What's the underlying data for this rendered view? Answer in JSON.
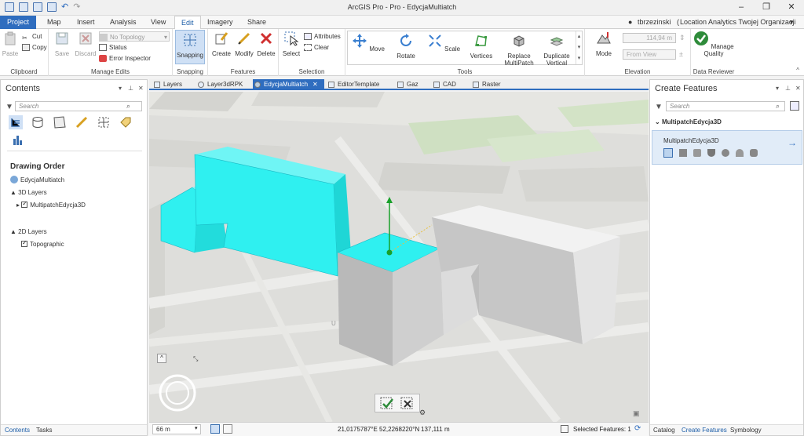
{
  "app_title": "ArcGIS Pro - Pro - EdycjaMultiatch",
  "window_controls": [
    "–",
    "❐",
    "✕"
  ],
  "tabs": [
    "Project",
    "Map",
    "Insert",
    "Analysis",
    "View",
    "Edit",
    "Imagery",
    "Share"
  ],
  "active_tab": "Edit",
  "user": "tbrzezinski",
  "organization": "Location Analytics Twojej Organizacji",
  "clipboard": {
    "paste": "Paste",
    "cut": "Cut",
    "copy": "Copy",
    "label": "Clipboard"
  },
  "manage_edits": {
    "save": "Save",
    "discard": "Discard",
    "topology": "No Topology",
    "status": "Status",
    "error_inspector": "Error Inspector",
    "label": "Manage Edits"
  },
  "snapping": {
    "button": "Snapping",
    "label": "Snapping"
  },
  "features": {
    "create": "Create",
    "modify": "Modify",
    "delete": "Delete",
    "label": "Features"
  },
  "selection": {
    "select": "Select",
    "attributes": "Attributes",
    "clear": "Clear",
    "label": "Selection"
  },
  "tools": {
    "items": [
      "Move",
      "Rotate",
      "Scale",
      "Vertices",
      "Replace MultiPatch",
      "Duplicate Vertical"
    ],
    "label": "Tools"
  },
  "elevation": {
    "mode": "Mode",
    "value": "114,94 m",
    "from_view": "From View",
    "label": "Elevation"
  },
  "data_reviewer": {
    "manage_quality": "Manage Quality",
    "label": "Data Reviewer"
  },
  "contents": {
    "title": "Contents",
    "search_placeholder": "Search",
    "drawing_order": "Drawing Order",
    "map_name": "EdycjaMultiatch",
    "group_3d": "3D Layers",
    "layer_3d": "MultipatchEdycja3D",
    "group_2d": "2D Layers",
    "layer_2d": "Topographic",
    "bottom_tabs": [
      "Contents",
      "Tasks"
    ]
  },
  "doc_tabs": [
    "Layers",
    "Layer3dRPK",
    "EdycjaMultiatch",
    "EditorTemplate",
    "Gaz",
    "CAD",
    "Raster"
  ],
  "active_doc_tab": "EdycjaMultiatch",
  "create_features": {
    "title": "Create Features",
    "search_placeholder": "Search",
    "group": "MultipatchEdycja3D",
    "template": "MultipatchEdycja3D",
    "bottom_tabs": [
      "Catalog",
      "Create Features",
      "Symbology"
    ]
  },
  "status": {
    "scale": "66 m",
    "coords": "21,0175787°E 52,2268220°N",
    "elevation": "137,111 m",
    "selected": "Selected Features: 1"
  },
  "colors": {
    "accent": "#2f6dbf",
    "selection": "#2ff0f0",
    "building": "#cfcfcf",
    "confirm": "#2e8b3a"
  }
}
